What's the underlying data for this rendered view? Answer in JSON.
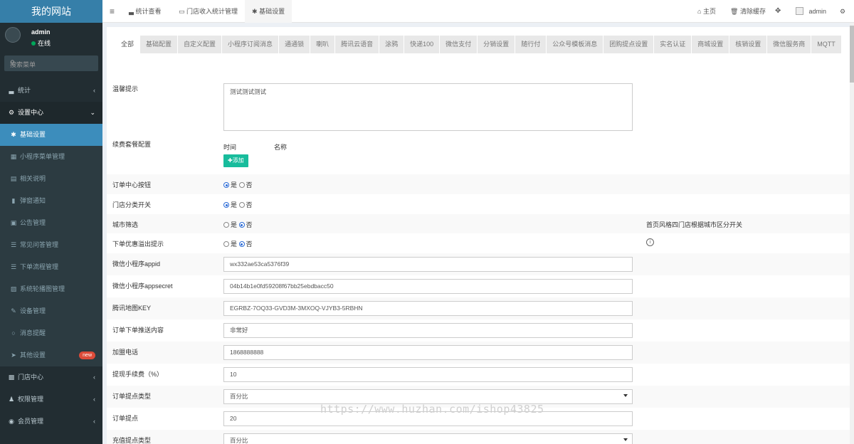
{
  "brand": "我的网站",
  "user": {
    "name": "admin",
    "status": "在线"
  },
  "search_placeholder": "搜索菜单",
  "sidebar": [
    {
      "label": "统计",
      "icon": "chart-icon",
      "glyph": "▃",
      "type": "top",
      "arrow": "‹"
    },
    {
      "label": "设置中心",
      "icon": "gears-icon",
      "glyph": "⚙",
      "type": "active-top",
      "arrow": "⌄"
    },
    {
      "label": "基础设置",
      "icon": "asterisk-icon",
      "glyph": "✱",
      "type": "sub sel",
      "arrow": ""
    },
    {
      "label": "小程序菜单管理",
      "icon": "grid-icon",
      "glyph": "▦",
      "type": "sub",
      "arrow": ""
    },
    {
      "label": "相关说明",
      "icon": "document-icon",
      "glyph": "▤",
      "type": "sub",
      "arrow": ""
    },
    {
      "label": "弹窗通知",
      "icon": "bookmark-icon",
      "glyph": "▮",
      "type": "sub",
      "arrow": ""
    },
    {
      "label": "公告管理",
      "icon": "notice-icon",
      "glyph": "▣",
      "type": "sub",
      "arrow": ""
    },
    {
      "label": "常见问答管理",
      "icon": "list-icon",
      "glyph": "☰",
      "type": "sub",
      "arrow": ""
    },
    {
      "label": "下单流程管理",
      "icon": "list-icon",
      "glyph": "☰",
      "type": "sub",
      "arrow": ""
    },
    {
      "label": "系统轮播图管理",
      "icon": "image-icon",
      "glyph": "▨",
      "type": "sub",
      "arrow": ""
    },
    {
      "label": "设备管理",
      "icon": "wrench-icon",
      "glyph": "✎",
      "type": "sub",
      "arrow": ""
    },
    {
      "label": "消息提醒",
      "icon": "circle-icon",
      "glyph": "○",
      "type": "sub",
      "arrow": ""
    },
    {
      "label": "其他设置",
      "icon": "send-icon",
      "glyph": "➤",
      "type": "sub",
      "arrow": "",
      "badge": "new"
    },
    {
      "label": "门店中心",
      "icon": "store-icon",
      "glyph": "▩",
      "type": "top",
      "arrow": "‹"
    },
    {
      "label": "权限管理",
      "icon": "users-icon",
      "glyph": "♟",
      "type": "top",
      "arrow": "‹"
    },
    {
      "label": "会员管理",
      "icon": "user-circle-icon",
      "glyph": "◉",
      "type": "top",
      "arrow": "‹"
    }
  ],
  "topbar": {
    "menu_glyph": "≡",
    "tabs": [
      {
        "label": "统计查看",
        "icon": "chart-icon",
        "glyph": "▃"
      },
      {
        "label": "门店收入统计管理",
        "icon": "document-icon",
        "glyph": "▭"
      },
      {
        "label": "基础设置",
        "icon": "asterisk-icon",
        "glyph": "✱"
      }
    ],
    "home": "主页",
    "clear_cache": "清除缓存",
    "admin": "admin"
  },
  "config_tabs": [
    "全部",
    "基础配置",
    "自定义配置",
    "小程序订阅消息",
    "通通锁",
    "喇叭",
    "腾讯云语音",
    "涂鸦",
    "快递100",
    "微信支付",
    "分销设置",
    "随行付",
    "公众号模板消息",
    "团购提点设置",
    "实名认证",
    "商城设置",
    "核销设置",
    "微信服务商",
    "MQTT"
  ],
  "form": {
    "tip_label": "温馨提示",
    "tip_value": "测试测试测试",
    "renew_label": "续费套餐配置",
    "renew_col_time": "时间",
    "renew_col_name": "名称",
    "add_button": "添加",
    "yes": "是",
    "no": "否",
    "order_center_label": "订单中心按钮",
    "store_category_label": "门店分类开关",
    "city_filter_label": "城市筛选",
    "city_filter_note": "首页风格四门店根据城市区分开关",
    "overflow_label": "下单优惠溢出提示",
    "appid_label": "微信小程序appid",
    "appid_value": "wx332ae53ca5376f39",
    "appsecret_label": "微信小程序appsecret",
    "appsecret_value": "04b14b1e0fd59208f67bb25ebdbacc50",
    "mapkey_label": "腾讯地图KEY",
    "mapkey_value": "EGRBZ-7OQ33-GVD3M-3MXOQ-VJYB3-5RBHN",
    "push_label": "订单下单推送内容",
    "push_value": "非常好",
    "phone_label": "加盟电话",
    "phone_value": "1868888888",
    "fee_label": "提现手续费（%）",
    "fee_value": "10",
    "commission_type_label": "订单提点类型",
    "commission_type_value": "百分比",
    "commission_label": "订单提点",
    "commission_value": "20",
    "recharge_type_label": "充值提点类型",
    "recharge_type_value": "百分比"
  },
  "watermark": "https://www.huzhan.com/ishop43825"
}
